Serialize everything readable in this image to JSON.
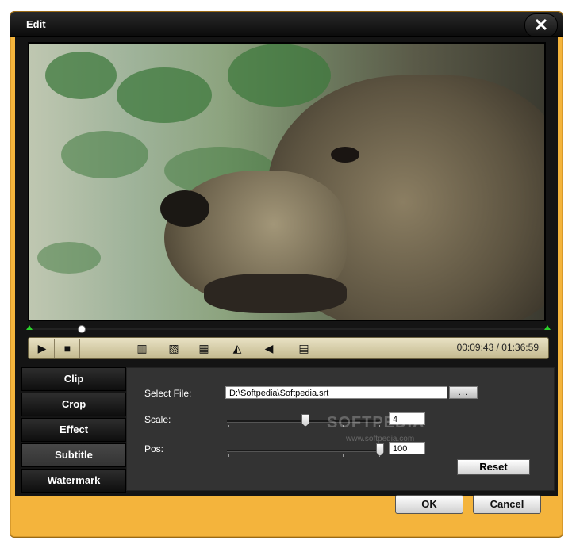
{
  "window": {
    "title": "Edit"
  },
  "player": {
    "timecode": "00:09:43 / 01:36:59",
    "progress": 0.1
  },
  "tabs": [
    {
      "label": "Clip"
    },
    {
      "label": "Crop"
    },
    {
      "label": "Effect"
    },
    {
      "label": "Subtitle"
    },
    {
      "label": "Watermark"
    }
  ],
  "subtitle": {
    "select_file_label": "Select File:",
    "file_path": "D:\\Softpedia\\Softpedia.srt",
    "browse_label": "...",
    "scale_label": "Scale:",
    "scale_value": "4",
    "pos_label": "Pos:",
    "pos_value": "100",
    "reset_label": "Reset"
  },
  "watermark_text": {
    "main": "SOFTPEDIA",
    "sub": "www.softpedia.com"
  },
  "footer": {
    "ok_label": "OK",
    "cancel_label": "Cancel"
  },
  "icons": [
    "play-icon",
    "stop-icon",
    "clip-icon",
    "crop-icon",
    "effect-icon",
    "flip-horizontal-icon",
    "rotate-icon",
    "snapshot-icon",
    "close-icon"
  ]
}
